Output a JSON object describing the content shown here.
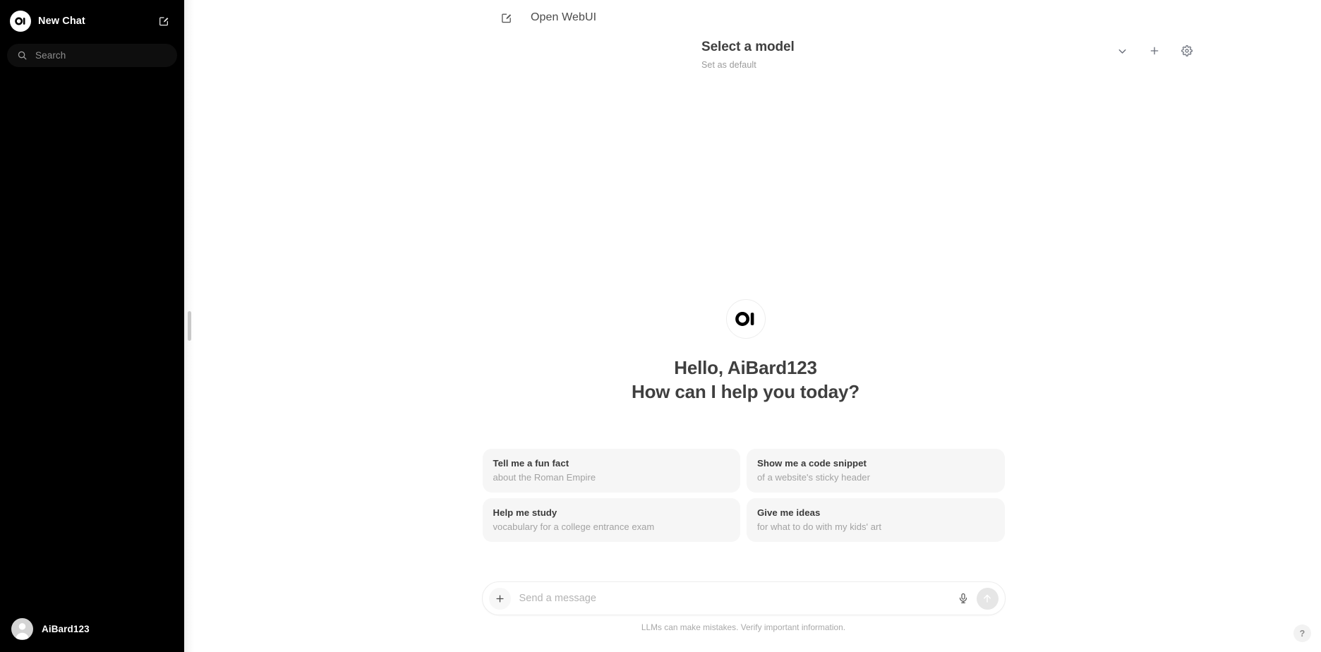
{
  "sidebar": {
    "logo_icon": "open-webui-logo",
    "new_chat_label": "New Chat",
    "new_chat_icon": "edit-square-icon",
    "search": {
      "icon": "search-icon",
      "placeholder": "Search",
      "value": ""
    },
    "chat_list": [],
    "footer": {
      "avatar_icon": "user-avatar-icon",
      "username": "AiBard123"
    },
    "background_color": "#000000"
  },
  "resizer": {
    "handle_icon": "sidebar-resize-grip"
  },
  "topbar": {
    "edit_icon": "edit-square-icon",
    "title": "Open WebUI"
  },
  "model_selector": {
    "selected_model": "Select a model",
    "set_as_default_label": "Set as default",
    "chevron_icon": "chevron-down-icon",
    "add_icon": "plus-icon",
    "settings_icon": "gear-icon"
  },
  "greeting": {
    "logo_icon": "open-webui-logo",
    "line1": "Hello, AiBard123",
    "line2": "How can I help you today?"
  },
  "suggestions": [
    {
      "title": "Tell me a fun fact",
      "subtitle": "about the Roman Empire"
    },
    {
      "title": "Show me a code snippet",
      "subtitle": "of a website's sticky header"
    },
    {
      "title": "Help me study",
      "subtitle": "vocabulary for a college entrance exam"
    },
    {
      "title": "Give me ideas",
      "subtitle": "for what to do with my kids' art"
    }
  ],
  "composer": {
    "plus_icon": "plus-icon",
    "placeholder": "Send a message",
    "value": "",
    "mic_icon": "microphone-icon",
    "send_icon": "arrow-up-icon",
    "disclaimer": "LLMs can make mistakes. Verify important information."
  },
  "help": {
    "label": "?",
    "icon": "question-mark-icon"
  },
  "theme": {
    "sidebar_bg": "#000000",
    "main_bg": "#ffffff",
    "suggestion_bg": "#f6f6f6",
    "muted_text": "#a2a2a2",
    "primary_text": "#3f3f3f"
  }
}
